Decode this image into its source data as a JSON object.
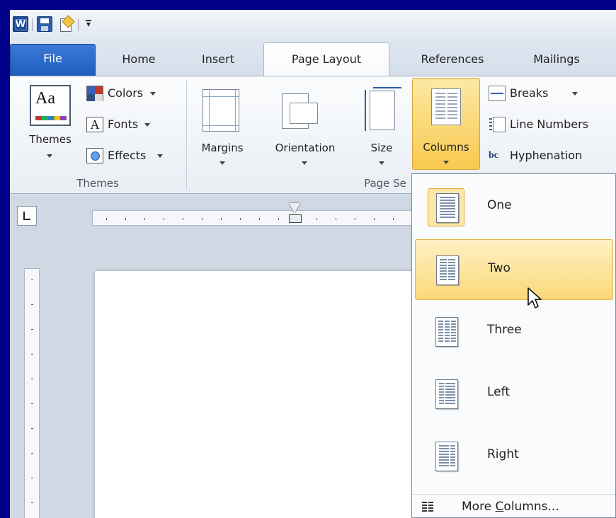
{
  "quick_access": {
    "word_icon_letter": "W"
  },
  "tabs": [
    {
      "label": "File"
    },
    {
      "label": "Home"
    },
    {
      "label": "Insert"
    },
    {
      "label": "Page Layout"
    },
    {
      "label": "References"
    },
    {
      "label": "Mailings"
    }
  ],
  "active_tab": "Page Layout",
  "ribbon": {
    "themes_group": {
      "themes_label": "Themes",
      "colors_label": "Colors",
      "fonts_label": "Fonts",
      "effects_label": "Effects",
      "group_label": "Themes"
    },
    "page_setup_group": {
      "margins_label": "Margins",
      "orientation_label": "Orientation",
      "size_label": "Size",
      "columns_label": "Columns",
      "breaks_label": "Breaks",
      "line_numbers_label": "Line Numbers",
      "hyphenation_label": "Hyphenation",
      "group_label": "Page Se"
    }
  },
  "columns_menu": {
    "items": [
      {
        "label": "One",
        "icon": "one-column-icon"
      },
      {
        "label": "Two",
        "icon": "two-columns-icon"
      },
      {
        "label": "Three",
        "icon": "three-columns-icon"
      },
      {
        "label": "Left",
        "icon": "left-column-icon"
      },
      {
        "label": "Right",
        "icon": "right-column-icon"
      }
    ],
    "current": "One",
    "hovered": "Two",
    "more_prefix": "More ",
    "more_accel": "C",
    "more_suffix": "olumns..."
  },
  "colors": {
    "frame": "#00008b",
    "accent_file_tab": "#2a66c9",
    "hover_gold": "#fbd97a"
  }
}
